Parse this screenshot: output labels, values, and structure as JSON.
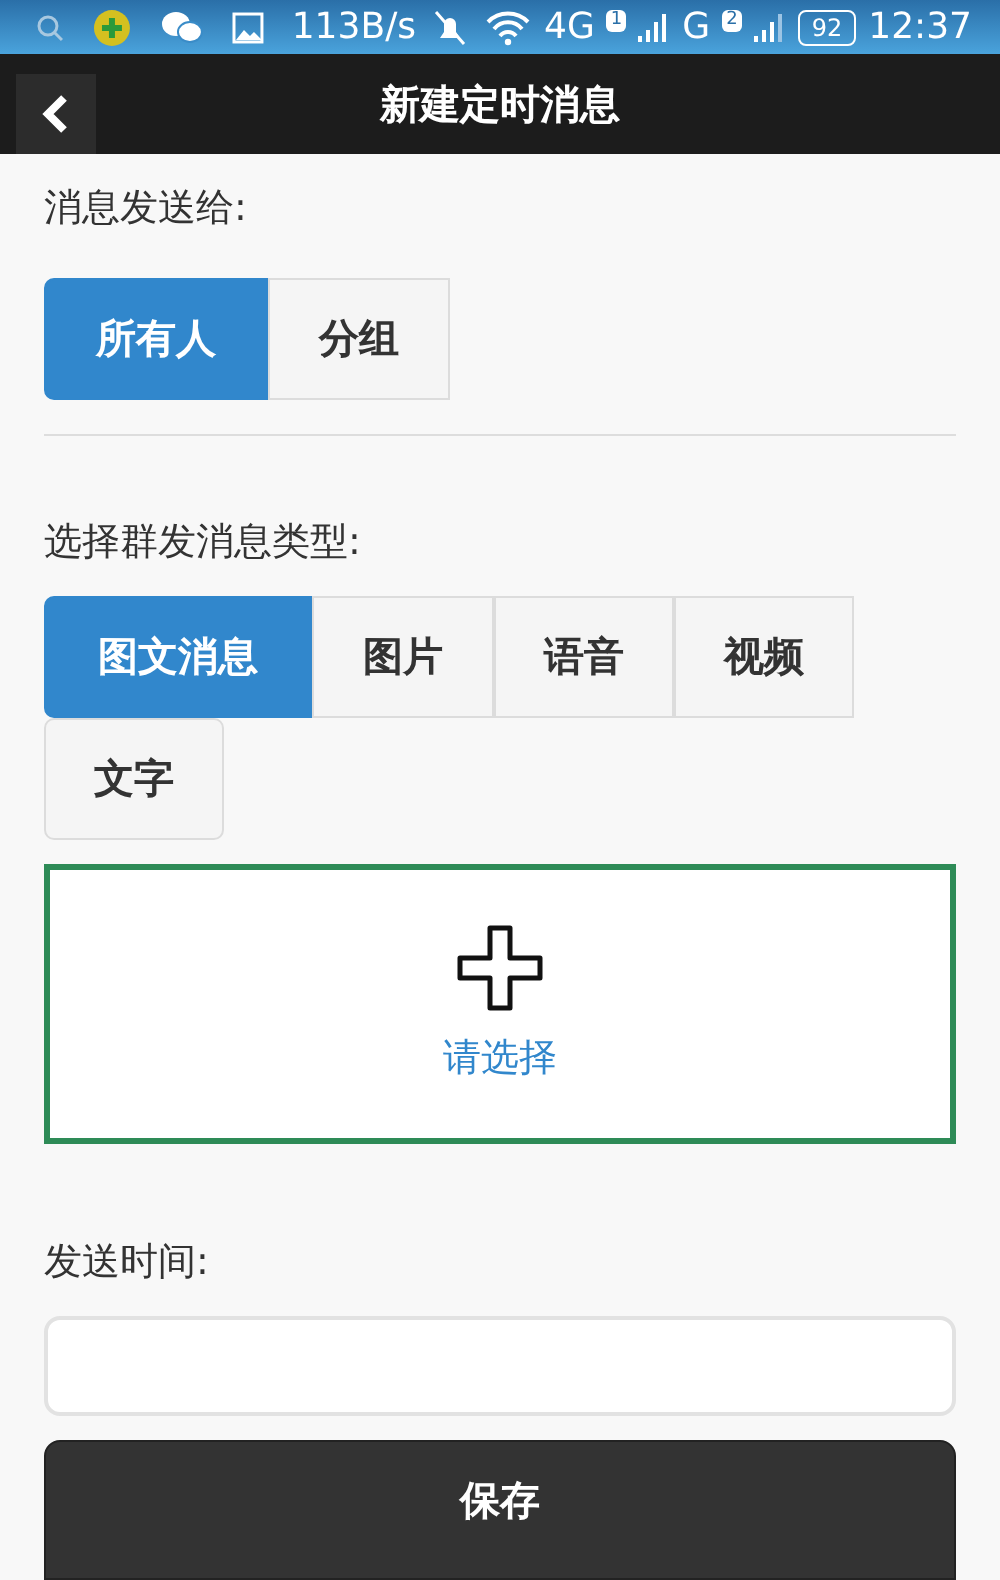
{
  "status_bar": {
    "network_speed": "113B/s",
    "network_4g": "4G",
    "sim1_badge": "1",
    "network_g": "G",
    "sim2_badge": "2",
    "battery": "92",
    "time": "12:37"
  },
  "header": {
    "title": "新建定时消息"
  },
  "recipients": {
    "label": "消息发送给:",
    "options": [
      {
        "label": "所有人",
        "selected": true
      },
      {
        "label": "分组",
        "selected": false
      }
    ]
  },
  "message_type": {
    "label": "选择群发消息类型:",
    "options": [
      {
        "label": "图文消息",
        "selected": true
      },
      {
        "label": "图片",
        "selected": false
      },
      {
        "label": "语音",
        "selected": false
      },
      {
        "label": "视频",
        "selected": false
      },
      {
        "label": "文字",
        "selected": false
      }
    ]
  },
  "picker": {
    "label": "请选择"
  },
  "send_time": {
    "label": "发送时间:"
  },
  "save_button": {
    "label": "保存"
  }
}
